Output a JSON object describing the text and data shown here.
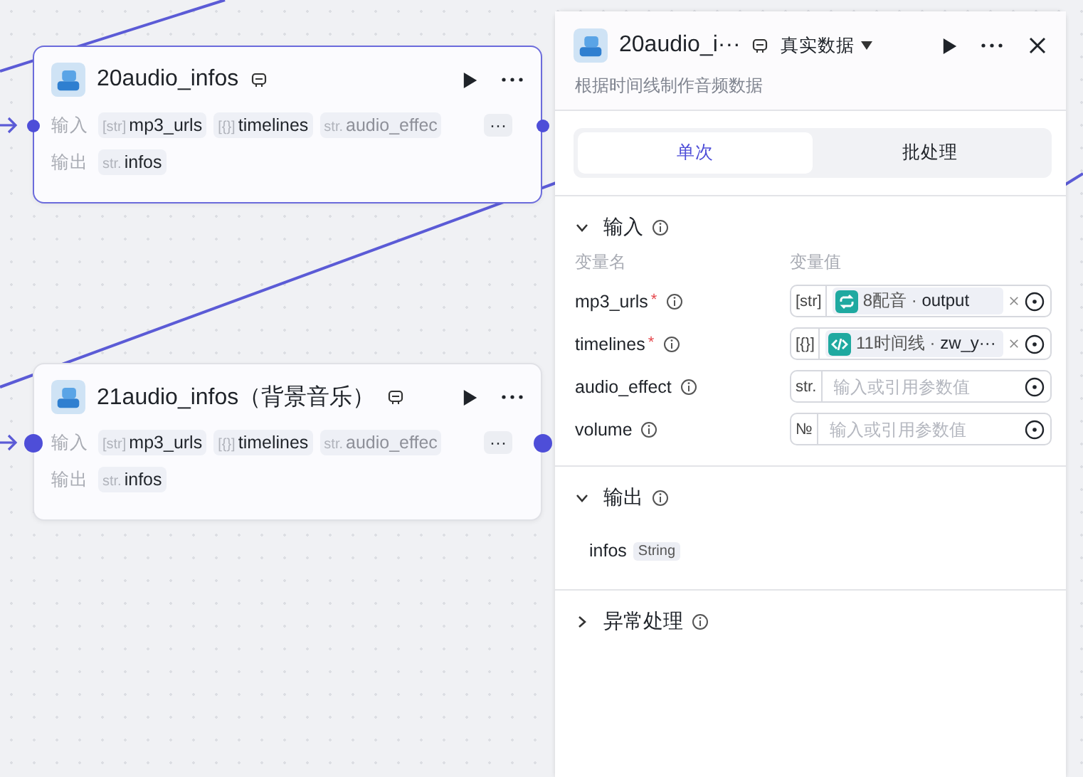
{
  "nodes": [
    {
      "title": "20audio_infos",
      "selected": true,
      "inputs_label": "输入",
      "outputs_label": "输出",
      "inputs": [
        {
          "tag": "[str]",
          "name": "mp3_urls"
        },
        {
          "tag": "[{}]",
          "name": "timelines"
        },
        {
          "tag": "str.",
          "name": "audio_effec"
        }
      ],
      "more": "···",
      "outputs": [
        {
          "tag": "str.",
          "name": "infos"
        }
      ]
    },
    {
      "title": "21audio_infos（背景音乐）",
      "selected": false,
      "inputs_label": "输入",
      "outputs_label": "输出",
      "inputs": [
        {
          "tag": "[str]",
          "name": "mp3_urls"
        },
        {
          "tag": "[{}]",
          "name": "timelines"
        },
        {
          "tag": "str.",
          "name": "audio_effec"
        }
      ],
      "more": "···",
      "outputs": [
        {
          "tag": "str.",
          "name": "infos"
        }
      ]
    }
  ],
  "panel": {
    "title": "20audio_i···",
    "data_mode": "真实数据",
    "description": "根据时间线制作音频数据",
    "tabs": [
      {
        "label": "单次",
        "selected": true
      },
      {
        "label": "批处理",
        "selected": false
      }
    ],
    "input_section": {
      "title": "输入",
      "expanded": true,
      "columns": [
        "变量名",
        "变量值"
      ],
      "params": [
        {
          "name": "mp3_urls",
          "required_mark": "*",
          "tag": "[str]",
          "kind": "loop",
          "value": "8配音 · **output**"
        },
        {
          "name": "timelines",
          "required_mark": "*",
          "tag": "[{}]",
          "kind": "code",
          "value": "11时间线 · **zw_y···**"
        },
        {
          "name": "audio_effect",
          "tag": "str.",
          "kind": "empty",
          "placeholder": "输入或引用参数值"
        },
        {
          "name": "volume",
          "tag": "№",
          "kind": "empty",
          "placeholder": "输入或引用参数值"
        }
      ]
    },
    "output_section": {
      "title": "输出",
      "expanded": true,
      "items": [
        {
          "name": "infos",
          "type": "String"
        }
      ]
    },
    "error_section": {
      "title": "异常处理",
      "expanded": false
    }
  }
}
